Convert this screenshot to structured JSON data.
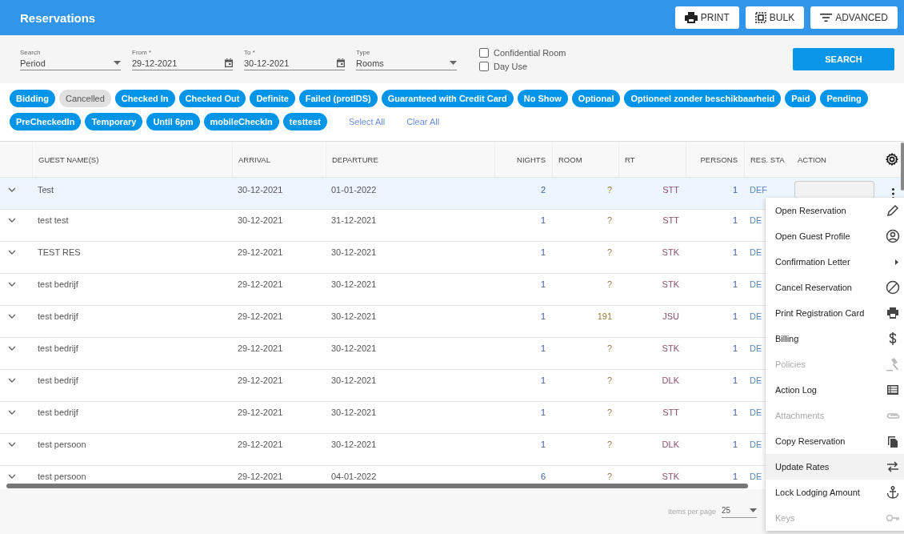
{
  "header": {
    "title": "Reservations",
    "buttons": [
      {
        "kind": "print",
        "label": "PRINT"
      },
      {
        "kind": "bulk",
        "label": "BULK"
      },
      {
        "kind": "filter",
        "label": "ADVANCED"
      }
    ]
  },
  "filters": {
    "fields": [
      {
        "kind": "select",
        "label": "Search",
        "value": "Period"
      },
      {
        "kind": "date",
        "label": "From *",
        "value": "29-12-2021"
      },
      {
        "kind": "date",
        "label": "To *",
        "value": "30-12-2021"
      },
      {
        "kind": "select",
        "label": "Type",
        "value": "Rooms"
      }
    ],
    "checkboxes": [
      {
        "label": "Confidential Room",
        "checked": false
      },
      {
        "label": "Day Use",
        "checked": false
      }
    ],
    "search_button": "SEARCH"
  },
  "status_chips": [
    {
      "label": "Bidding",
      "selected": true
    },
    {
      "label": "Cancelled",
      "selected": false
    },
    {
      "label": "Checked In",
      "selected": true
    },
    {
      "label": "Checked Out",
      "selected": true
    },
    {
      "label": "Definite",
      "selected": true
    },
    {
      "label": "Failed (protIDS)",
      "selected": true
    },
    {
      "label": "Guaranteed with Credit Card",
      "selected": true
    },
    {
      "label": "No Show",
      "selected": true
    },
    {
      "label": "Optional",
      "selected": true
    },
    {
      "label": "Optioneel zonder beschikbaarheid",
      "selected": true
    },
    {
      "label": "Paid",
      "selected": true
    },
    {
      "label": "Pending",
      "selected": true
    },
    {
      "label": "PreCheckedIn",
      "selected": true
    },
    {
      "label": "Temporary",
      "selected": true
    },
    {
      "label": "Until 6pm",
      "selected": true
    },
    {
      "label": "mobileCheckIn",
      "selected": true
    },
    {
      "label": "testtest",
      "selected": true
    }
  ],
  "chip_links": [
    "Select All",
    "Clear All"
  ],
  "table": {
    "columns": [
      "GUEST NAME(S)",
      "ARRIVAL",
      "DEPARTURE",
      "NIGHTS",
      "ROOM",
      "RT",
      "PERSONS",
      "RES. STA",
      "ACTION"
    ],
    "rows": [
      {
        "selected": true,
        "actions": true,
        "guest": "Test",
        "arrival": "30-12-2021",
        "departure": "01-01-2022",
        "nights": "2",
        "room": "?",
        "rt": "STT",
        "persons": "1",
        "status": "DEF"
      },
      {
        "selected": false,
        "actions": false,
        "guest": "test test",
        "arrival": "30-12-2021",
        "departure": "31-12-2021",
        "nights": "1",
        "room": "?",
        "rt": "STT",
        "persons": "1",
        "status": "DE"
      },
      {
        "selected": false,
        "actions": false,
        "guest": "TEST RES",
        "arrival": "29-12-2021",
        "departure": "30-12-2021",
        "nights": "1",
        "room": "?",
        "rt": "STK",
        "persons": "1",
        "status": "DE"
      },
      {
        "selected": false,
        "actions": false,
        "guest": "test bedrijf",
        "arrival": "29-12-2021",
        "departure": "30-12-2021",
        "nights": "1",
        "room": "?",
        "rt": "STK",
        "persons": "1",
        "status": "DE"
      },
      {
        "selected": false,
        "actions": false,
        "guest": "test bedrijf",
        "arrival": "29-12-2021",
        "departure": "30-12-2021",
        "nights": "1",
        "room": "191",
        "rt": "JSU",
        "persons": "1",
        "status": "DE"
      },
      {
        "selected": false,
        "actions": false,
        "guest": "test bedrijf",
        "arrival": "29-12-2021",
        "departure": "30-12-2021",
        "nights": "1",
        "room": "?",
        "rt": "STK",
        "persons": "1",
        "status": "DE"
      },
      {
        "selected": false,
        "actions": false,
        "guest": "test bedrijf",
        "arrival": "29-12-2021",
        "departure": "30-12-2021",
        "nights": "1",
        "room": "?",
        "rt": "DLK",
        "persons": "1",
        "status": "DE"
      },
      {
        "selected": false,
        "actions": false,
        "guest": "test bedrijf",
        "arrival": "29-12-2021",
        "departure": "30-12-2021",
        "nights": "1",
        "room": "?",
        "rt": "STT",
        "persons": "1",
        "status": "DE"
      },
      {
        "selected": false,
        "actions": false,
        "guest": "test persoon",
        "arrival": "29-12-2021",
        "departure": "30-12-2021",
        "nights": "1",
        "room": "?",
        "rt": "DLK",
        "persons": "1",
        "status": "DE"
      },
      {
        "selected": false,
        "actions": false,
        "guest": "test persoon",
        "arrival": "29-12-2021",
        "departure": "04-01-2022",
        "nights": "6",
        "room": "?",
        "rt": "STK",
        "persons": "1",
        "status": "DE"
      }
    ]
  },
  "context_menu": {
    "items": [
      {
        "label": "Open Reservation",
        "kind": "pencil",
        "disabled": false,
        "highlighted": false
      },
      {
        "label": "Open Guest Profile",
        "kind": "person",
        "disabled": false,
        "highlighted": false
      },
      {
        "label": "Confirmation Letter",
        "kind": "submenu",
        "disabled": false,
        "highlighted": false
      },
      {
        "label": "Cancel Reservation",
        "kind": "ban",
        "disabled": false,
        "highlighted": false
      },
      {
        "label": "Print Registration Card",
        "kind": "printer",
        "disabled": false,
        "highlighted": false
      },
      {
        "label": "Billing",
        "kind": "dollar",
        "disabled": false,
        "highlighted": false
      },
      {
        "label": "Policies",
        "kind": "gavel",
        "disabled": true,
        "highlighted": false
      },
      {
        "label": "Action Log",
        "kind": "list",
        "disabled": false,
        "highlighted": false
      },
      {
        "label": "Attachments",
        "kind": "clip",
        "disabled": true,
        "highlighted": false
      },
      {
        "label": "Copy Reservation",
        "kind": "copy",
        "disabled": false,
        "highlighted": false
      },
      {
        "label": "Update Rates",
        "kind": "swap",
        "disabled": false,
        "highlighted": true
      },
      {
        "label": "Lock Lodging Amount",
        "kind": "anchor",
        "disabled": false,
        "highlighted": false
      },
      {
        "label": "Keys",
        "kind": "key",
        "disabled": true,
        "highlighted": false
      }
    ]
  },
  "pagination": {
    "label": "Items per page",
    "value": "25"
  }
}
